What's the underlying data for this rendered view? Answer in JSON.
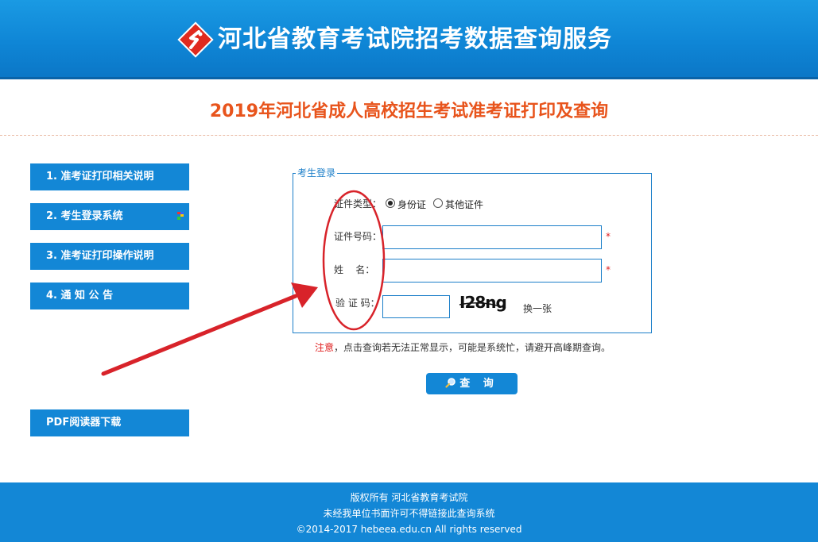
{
  "header": {
    "site_title": "河北省教育考试院招考数据查询服务",
    "brand_color": "#1387d6"
  },
  "page_title": "2019年河北省成人高校招生考试准考证打印及查询",
  "sidebar": {
    "items": [
      {
        "label": "1. 准考证打印相关说明"
      },
      {
        "label": "2. 考生登录系统"
      },
      {
        "label": "3. 准考证打印操作说明"
      },
      {
        "label": "4. 通 知 公 告"
      }
    ],
    "pdf_label": "PDF阅读器下载"
  },
  "login": {
    "legend": "考生登录",
    "id_type_label": "证件类型：",
    "id_type_options": [
      {
        "label": "身份证",
        "checked": true
      },
      {
        "label": "其他证件",
        "checked": false
      }
    ],
    "id_number_label": "证件号码：",
    "id_number_value": "",
    "name_label": "姓    名：",
    "name_value": "",
    "captcha_label": "验 证 码：",
    "captcha_value": "",
    "captcha_text": "I28ng",
    "required_mark": "*",
    "refresh_label": "换一张"
  },
  "notice": {
    "key": "注意",
    "text": "，点击查询若无法正常显示，可能是系统忙，请避开高峰期查询。"
  },
  "query_button": {
    "label": "查 询",
    "icon": "search-icon"
  },
  "footer": {
    "line1": "版权所有 河北省教育考试院",
    "line2": "未经我单位书面许可不得链接此查询系统",
    "line3": "©2014-2017 hebeea.edu.cn All rights reserved"
  }
}
